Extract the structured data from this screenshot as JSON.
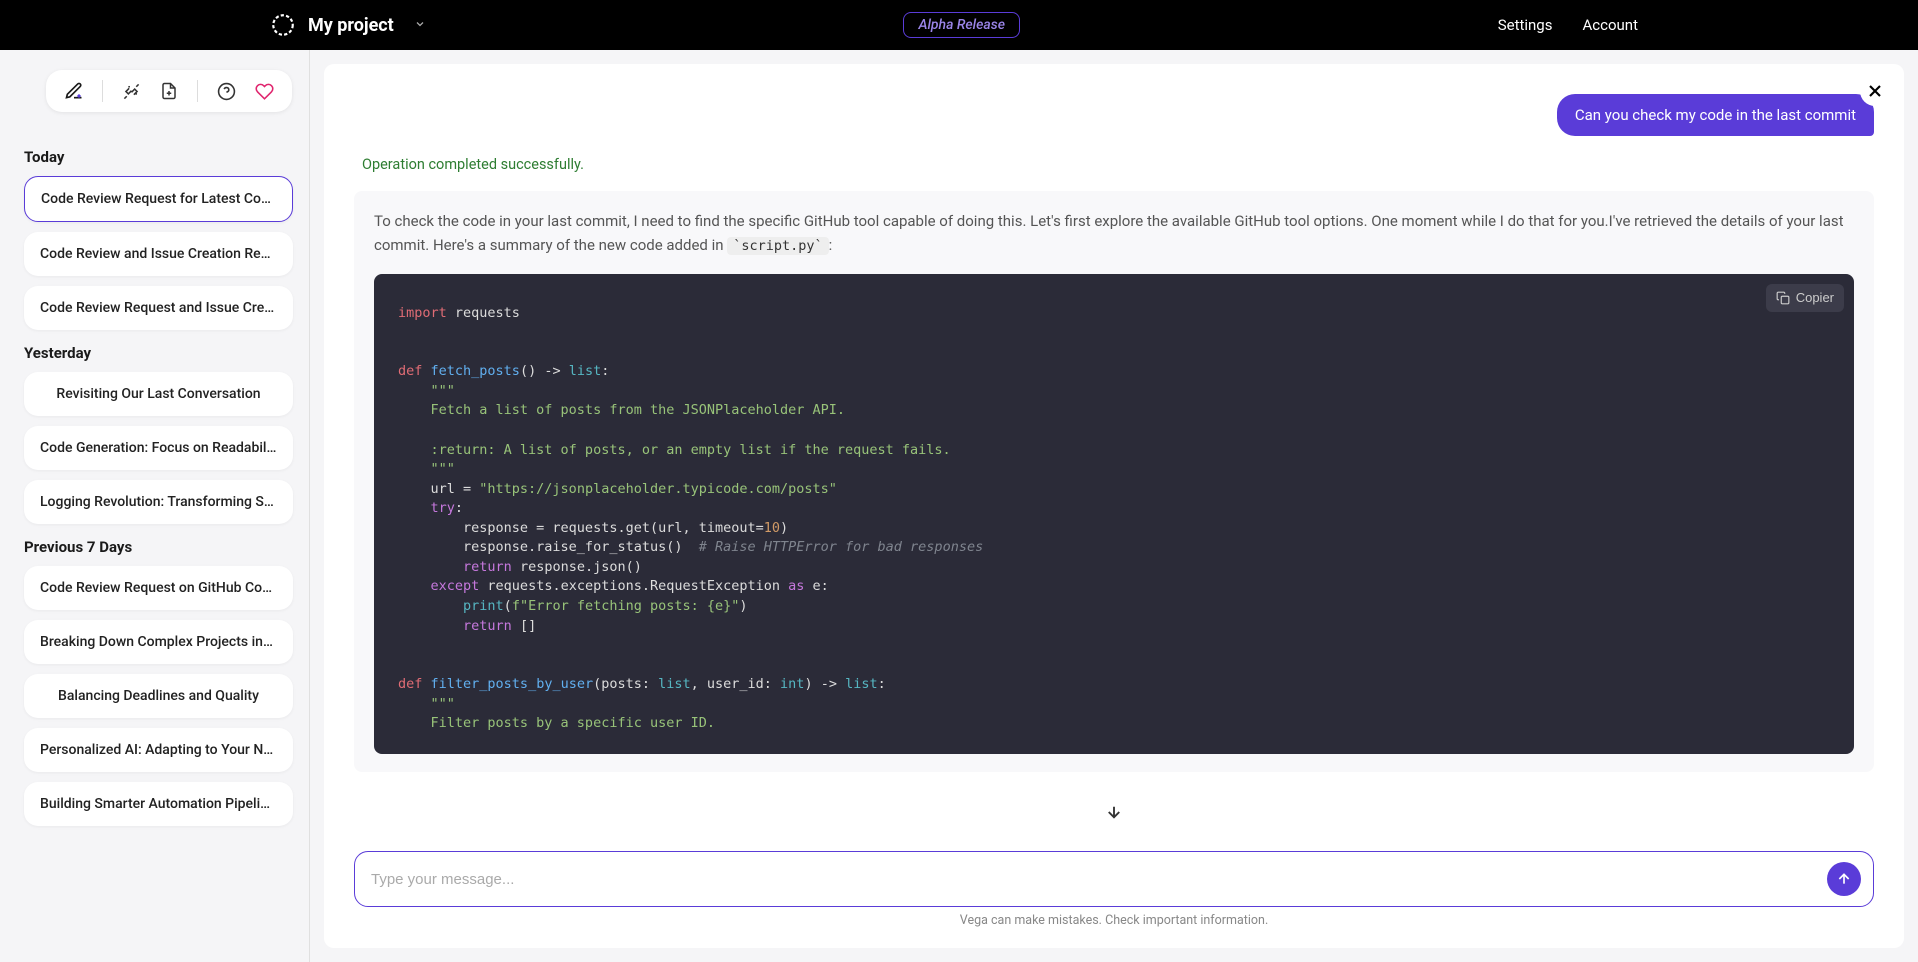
{
  "header": {
    "project_name": "My project",
    "alpha_label": "Alpha Release",
    "settings_label": "Settings",
    "account_label": "Account"
  },
  "sidebar": {
    "sections": [
      {
        "title": "Today",
        "items": [
          "Code Review Request for Latest Commit",
          "Code Review and Issue Creation Request",
          "Code Review Request and Issue Creation"
        ]
      },
      {
        "title": "Yesterday",
        "items": [
          "Revisiting Our Last Conversation",
          "Code Generation: Focus on Readability ...",
          "Logging Revolution: Transforming Scrip..."
        ]
      },
      {
        "title": "Previous 7 Days",
        "items": [
          "Code Review Request on GitHub Commit",
          "Breaking Down Complex Projects into ...",
          "Balancing Deadlines and Quality",
          "Personalized AI: Adapting to Your Needs",
          "Building Smarter Automation Pipelines"
        ]
      }
    ]
  },
  "chat": {
    "user_message": "Can you check my code in the last commit",
    "success_message": "Operation completed successfully.",
    "assistant_text_1": "To check the code in your last commit, I need to find the specific GitHub tool capable of doing this. Let's first explore the available GitHub tool options. One moment while I do that for you.I've retrieved the details of your last commit. Here's a summary of the new code added in ",
    "assistant_code_ref": "`script.py`",
    "assistant_text_2": ":",
    "copy_label": "Copier"
  },
  "input": {
    "placeholder": "Type your message..."
  },
  "disclaimer": "Vega can make mistakes. Check important information."
}
